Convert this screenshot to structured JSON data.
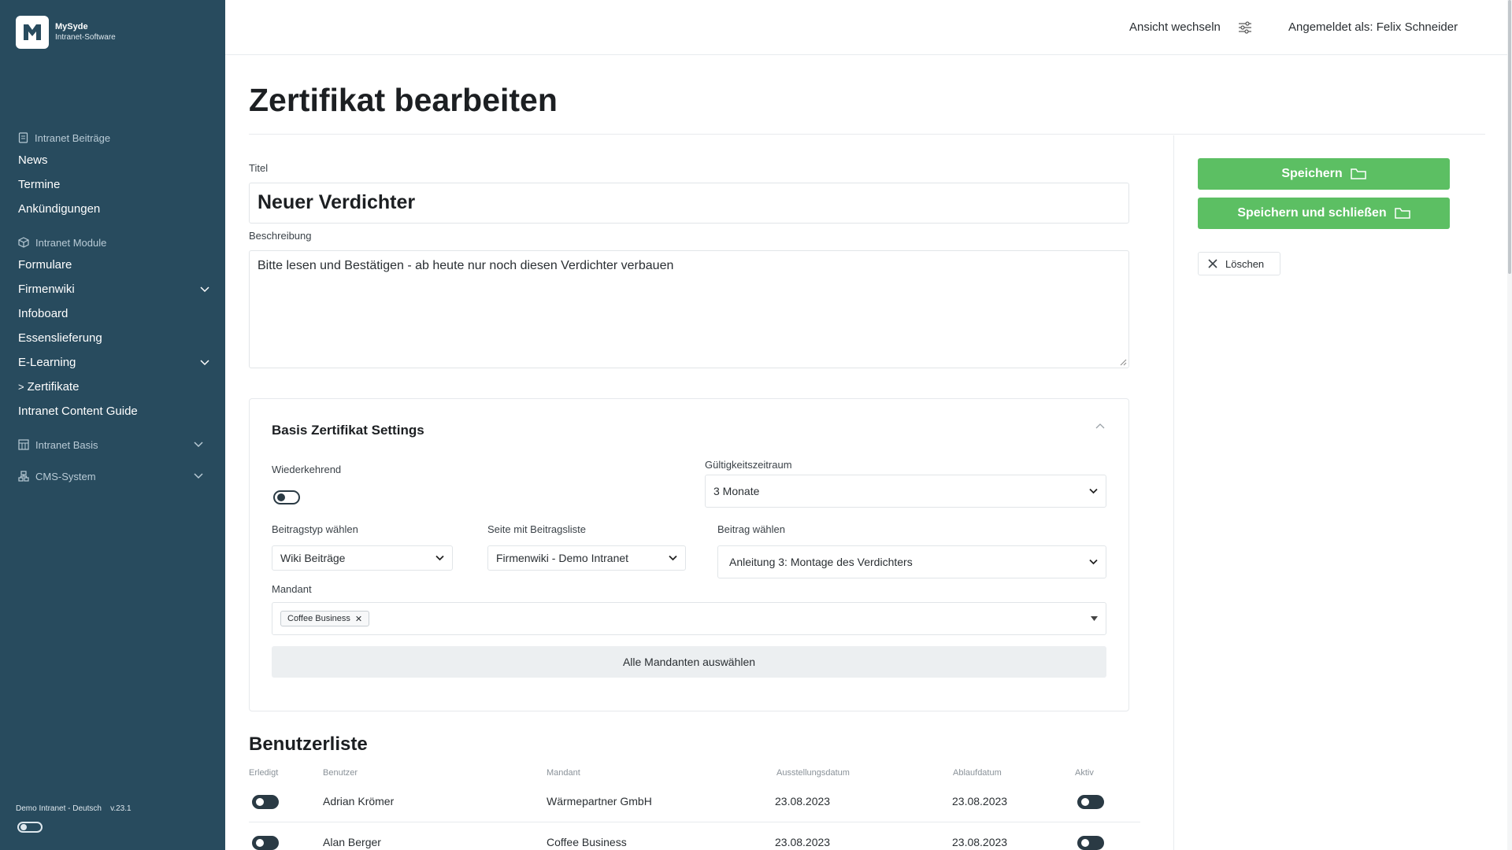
{
  "brand": {
    "name": "MySyde",
    "subtitle": "Intranet-Software"
  },
  "sidebar": {
    "groups": [
      {
        "label": "Intranet Beiträge",
        "icon": "document-icon",
        "items": [
          {
            "label": "News"
          },
          {
            "label": "Termine"
          },
          {
            "label": "Ankündigungen"
          }
        ]
      },
      {
        "label": "Intranet Module",
        "icon": "box-icon",
        "items": [
          {
            "label": "Formulare"
          },
          {
            "label": "Firmenwiki",
            "expandable": true
          },
          {
            "label": "Infoboard"
          },
          {
            "label": "Essenslieferung"
          },
          {
            "label": "E-Learning",
            "expandable": true
          },
          {
            "label": "Zertifikate",
            "active": true,
            "prefix": ">"
          },
          {
            "label": "Intranet Content Guide"
          }
        ]
      },
      {
        "label": "Intranet Basis",
        "icon": "grid-icon",
        "expandable": true
      },
      {
        "label": "CMS-System",
        "icon": "network-icon",
        "expandable": true
      }
    ],
    "footer": {
      "text": "Demo Intranet - Deutsch",
      "version": "v.23.1"
    }
  },
  "topbar": {
    "view_switch": "Ansicht wechseln",
    "user": "Angemeldet als: Felix Schneider"
  },
  "page": {
    "title": "Zertifikat bearbeiten",
    "title_label": "Titel",
    "title_value": "Neuer Verdichter",
    "description_label": "Beschreibung",
    "description_value": "Bitte lesen und Bestätigen - ab heute nur noch diesen Verdichter verbauen"
  },
  "settings": {
    "heading": "Basis Zertifikat Settings",
    "recurring_label": "Wiederkehrend",
    "recurring_on": false,
    "validity_label": "Gültigkeitszeitraum",
    "validity_value": "3 Monate",
    "post_type_label": "Beitragstyp wählen",
    "post_type_value": "Wiki Beiträge",
    "post_list_label": "Seite mit Beitragsliste",
    "post_list_value": "Firmenwiki - Demo Intranet",
    "post_label": "Beitrag wählen",
    "post_value": "Anleitung 3: Montage des Verdichters",
    "client_label": "Mandant",
    "client_tags": [
      "Coffee Business"
    ],
    "select_all": "Alle Mandanten auswählen"
  },
  "users": {
    "heading": "Benutzerliste",
    "columns": [
      "Erledigt",
      "Benutzer",
      "Mandant",
      "Ausstellungsdatum",
      "Ablaufdatum",
      "Aktiv"
    ],
    "rows": [
      {
        "done": false,
        "user": "Adrian Krömer",
        "client": "Wärmepartner GmbH",
        "issued": "23.08.2023",
        "expires": "23.08.2023",
        "active": false
      },
      {
        "done": false,
        "user": "Alan Berger",
        "client": "Coffee Business",
        "issued": "23.08.2023",
        "expires": "23.08.2023",
        "active": false
      }
    ]
  },
  "actions": {
    "save": "Speichern",
    "save_close": "Speichern und schließen",
    "delete": "Löschen"
  },
  "colors": {
    "sidebar": "#284b5e",
    "primary": "#5cbf63",
    "toggle": "#2a3a44"
  }
}
